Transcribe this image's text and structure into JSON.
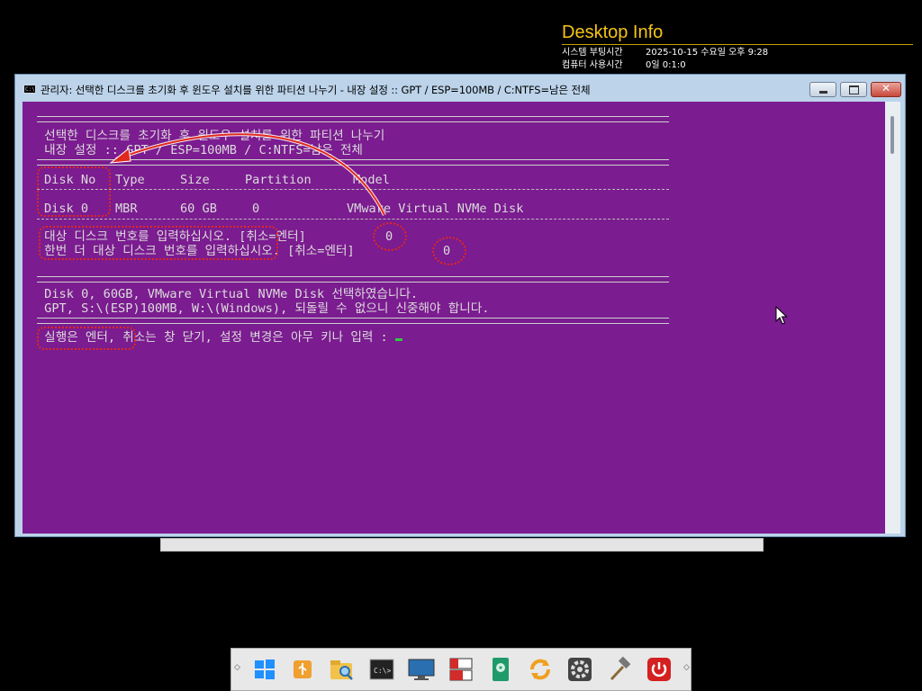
{
  "desktop_info": {
    "title": "Desktop Info",
    "rows": [
      {
        "label": "시스템 부팅시간",
        "value": "2025-10-15 수요일 오후 9:28"
      },
      {
        "label": "컴퓨터 사용시간",
        "value": "0일 0:1:0"
      }
    ]
  },
  "window": {
    "title": "관리자:  선택한 디스크를 초기화 후 윈도우 설치를 위한 파티션 나누기 - 내장 설정 :: GPT / ESP=100MB / C:NTFS=남은 전체",
    "icon_text": "C:\\"
  },
  "console": {
    "header_line1": " 선택한 디스크를 초기화 후 윈도우 설치를 위한 파티션 나누기",
    "header_line2": " 내장 설정 :: GPT / ESP=100MB / C:NTFS=남은 전체",
    "table_header": {
      "disk_no": "Disk No",
      "type": "Type",
      "size": "Size",
      "partition": "Partition",
      "model": "Model"
    },
    "table_row": {
      "disk_no": "Disk 0",
      "type": "MBR",
      "size": "60 GB",
      "partition": "0",
      "model": "VMware Virtual NVMe Disk"
    },
    "prompt1_label": " 대상 디스크 번호를 입력하십시오. [취소=엔터]",
    "prompt1_value": "0",
    "prompt2_label": " 한번 더 대상 디스크 번호를 입력하십시오. [취소=엔터]",
    "prompt2_value": "0",
    "selected_line1": " Disk 0, 60GB, VMware Virtual NVMe Disk 선택하였습니다.",
    "selected_line2": " GPT, S:\\(ESP)100MB, W:\\(Windows), 되돌릴 수 없으니 신중해야 합니다.",
    "confirm_prompt": " 실행은 엔터, 취소는 창 닫기, 설정 변경은 아무 키나 입력 : "
  },
  "taskbar": {
    "items": [
      {
        "name": "windows-start-icon",
        "color": "#1e90ff"
      },
      {
        "name": "usb-drive-icon",
        "color": "#f0a030"
      },
      {
        "name": "file-explorer-search-icon",
        "color": "#f2c24a"
      },
      {
        "name": "command-prompt-icon",
        "color": "#222222"
      },
      {
        "name": "monitor-icon",
        "color": "#2a6fb0"
      },
      {
        "name": "partition-tool-icon",
        "color": "#d12b2b"
      },
      {
        "name": "disk-utility-icon",
        "color": "#1f9a6b"
      },
      {
        "name": "sync-icon",
        "color": "#f0a020"
      },
      {
        "name": "settings-gear-icon",
        "color": "#444444"
      },
      {
        "name": "tools-hammer-icon",
        "color": "#666666"
      },
      {
        "name": "power-icon",
        "color": "#d42020"
      }
    ]
  }
}
